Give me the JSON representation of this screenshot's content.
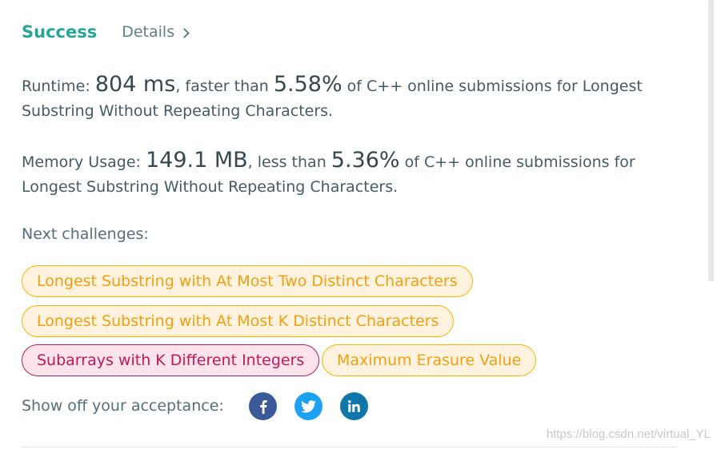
{
  "header": {
    "status": "Success",
    "details_label": "Details"
  },
  "runtime": {
    "label": "Runtime:",
    "value": "804 ms",
    "compare": ", faster than",
    "percent": "5.58%",
    "suffix": "of C++ online submissions for Longest Substring Without Repeating Characters."
  },
  "memory": {
    "label": "Memory Usage:",
    "value": "149.1 MB",
    "compare": ", less than",
    "percent": "5.36%",
    "suffix": "of C++ online submissions for Longest Substring Without Repeating Characters."
  },
  "next_challenges": {
    "label": "Next challenges:",
    "items": [
      {
        "title": "Longest Substring with At Most Two Distinct Characters",
        "difficulty": "medium"
      },
      {
        "title": "Longest Substring with At Most K Distinct Characters",
        "difficulty": "medium"
      },
      {
        "title": "Subarrays with K Different Integers",
        "difficulty": "hard"
      },
      {
        "title": "Maximum Erasure Value",
        "difficulty": "medium"
      }
    ]
  },
  "share": {
    "label": "Show off your acceptance:",
    "networks": [
      {
        "icon": "facebook-icon",
        "color": "#3b5998"
      },
      {
        "icon": "twitter-icon",
        "color": "#1da1f2"
      },
      {
        "icon": "linkedin-icon",
        "color": "#0e76a8"
      }
    ]
  },
  "watermark": "https://blog.csdn.net/virtual_YL",
  "colors": {
    "success": "#26a69a",
    "medium": "#f0a012",
    "hard": "#c2185b"
  }
}
